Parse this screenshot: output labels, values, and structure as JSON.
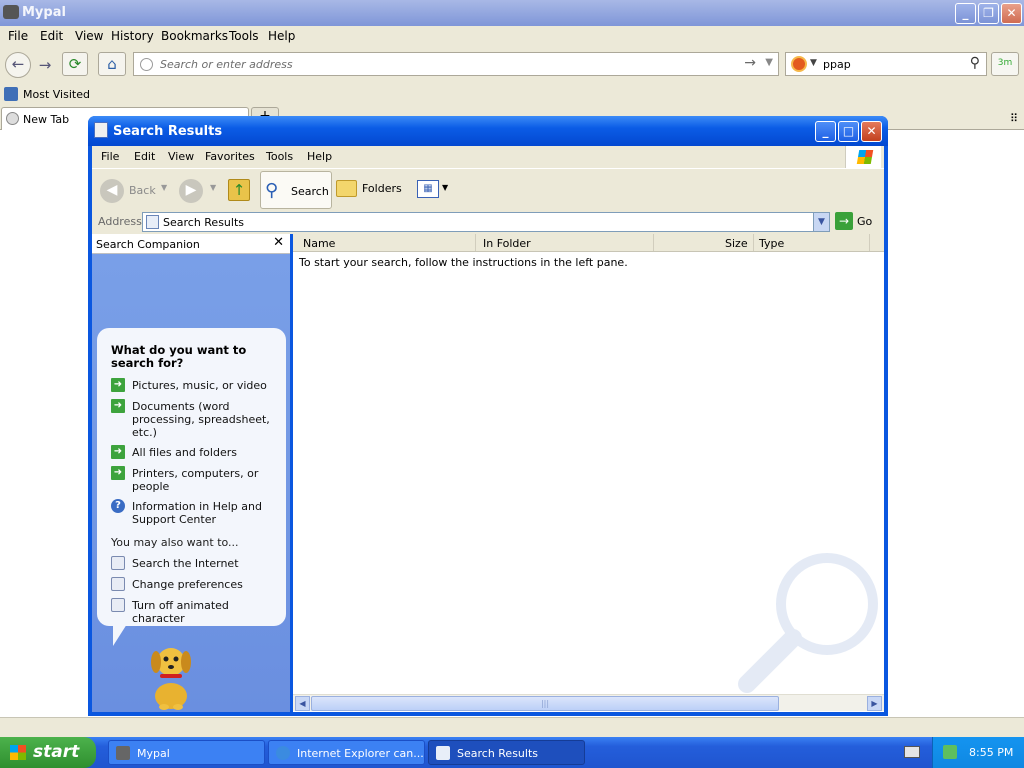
{
  "browser": {
    "title": "Mypal",
    "menu": [
      "File",
      "Edit",
      "View",
      "History",
      "Bookmarks",
      "Tools",
      "Help"
    ],
    "address_placeholder": "Search or enter address",
    "search_value": "ppap",
    "addon_label": "3m",
    "bookmarks_item": "Most Visited",
    "tab_label": "New Tab",
    "new_tab_symbol": "+"
  },
  "explorer": {
    "title": "Search Results",
    "menu": [
      "File",
      "Edit",
      "View",
      "Favorites",
      "Tools",
      "Help"
    ],
    "toolbar": {
      "back": "Back",
      "search": "Search",
      "folders": "Folders"
    },
    "address_label": "Address",
    "address_value": "Search Results",
    "go_label": "Go",
    "companion_title": "Search Companion",
    "question": "What do you want to search for?",
    "options": [
      "Pictures, music, or video",
      "Documents (word processing, spreadsheet, etc.)",
      "All files and folders",
      "Printers, computers, or people",
      "Information in Help and Support Center"
    ],
    "also_label": "You may also want to...",
    "also_options": [
      "Search the Internet",
      "Change preferences",
      "Turn off animated character"
    ],
    "columns": [
      "Name",
      "In Folder",
      "Size",
      "Type"
    ],
    "empty_message": "To start your search, follow the instructions in the left pane."
  },
  "taskbar": {
    "start": "start",
    "tasks": [
      "Mypal",
      "Internet Explorer can...",
      "Search Results"
    ],
    "clock": "8:55 PM"
  }
}
